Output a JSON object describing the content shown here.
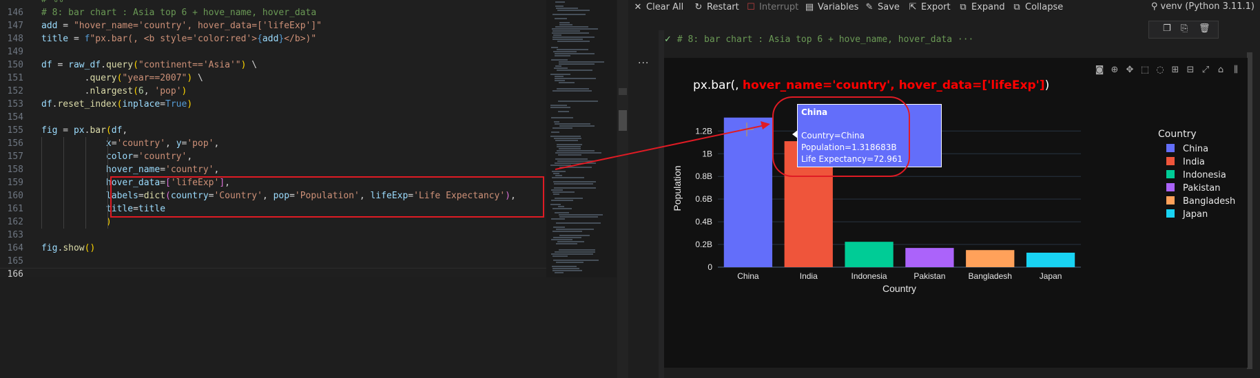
{
  "editor": {
    "lines": [
      {
        "no": "",
        "parts": [
          {
            "c": "t-c",
            "t": "# %%"
          }
        ]
      },
      {
        "no": "146",
        "parts": [
          {
            "c": "t-c",
            "t": "# 8: bar chart : Asia top 6 + hove_name, hover_data"
          }
        ]
      },
      {
        "no": "147",
        "parts": [
          {
            "c": "t-v",
            "t": "add"
          },
          {
            "c": "t-p",
            "t": " = "
          },
          {
            "c": "t-s",
            "t": "\"hover_name='country', hover_data=['lifeExp']\""
          }
        ]
      },
      {
        "no": "148",
        "parts": [
          {
            "c": "t-v",
            "t": "title"
          },
          {
            "c": "t-p",
            "t": " = "
          },
          {
            "c": "t-k",
            "t": "f"
          },
          {
            "c": "t-s",
            "t": "\"px.bar(, <b style='color:red'>"
          },
          {
            "c": "t-k",
            "t": "{"
          },
          {
            "c": "t-v",
            "t": "add"
          },
          {
            "c": "t-k",
            "t": "}"
          },
          {
            "c": "t-s",
            "t": "</b>)\""
          }
        ]
      },
      {
        "no": "149",
        "parts": []
      },
      {
        "no": "150",
        "parts": [
          {
            "c": "t-v",
            "t": "df"
          },
          {
            "c": "t-p",
            "t": " = "
          },
          {
            "c": "t-v",
            "t": "raw_df"
          },
          {
            "c": "t-p",
            "t": "."
          },
          {
            "c": "t-f",
            "t": "query"
          },
          {
            "c": "t-y",
            "t": "("
          },
          {
            "c": "t-s",
            "t": "\"continent=='Asia'\""
          },
          {
            "c": "t-y",
            "t": ")"
          },
          {
            "c": "t-p",
            "t": " \\"
          }
        ]
      },
      {
        "no": "151",
        "parts": [
          {
            "c": "t-p",
            "t": "        ."
          },
          {
            "c": "t-f",
            "t": "query"
          },
          {
            "c": "t-y",
            "t": "("
          },
          {
            "c": "t-s",
            "t": "\"year==2007\""
          },
          {
            "c": "t-y",
            "t": ")"
          },
          {
            "c": "t-p",
            "t": " \\"
          }
        ]
      },
      {
        "no": "152",
        "parts": [
          {
            "c": "t-p",
            "t": "        ."
          },
          {
            "c": "t-f",
            "t": "nlargest"
          },
          {
            "c": "t-y",
            "t": "("
          },
          {
            "c": "t-n",
            "t": "6"
          },
          {
            "c": "t-p",
            "t": ", "
          },
          {
            "c": "t-s",
            "t": "'pop'"
          },
          {
            "c": "t-y",
            "t": ")"
          }
        ]
      },
      {
        "no": "153",
        "parts": [
          {
            "c": "t-v",
            "t": "df"
          },
          {
            "c": "t-p",
            "t": "."
          },
          {
            "c": "t-f",
            "t": "reset_index"
          },
          {
            "c": "t-y",
            "t": "("
          },
          {
            "c": "t-v",
            "t": "inplace"
          },
          {
            "c": "t-p",
            "t": "="
          },
          {
            "c": "t-k",
            "t": "True"
          },
          {
            "c": "t-y",
            "t": ")"
          }
        ]
      },
      {
        "no": "154",
        "parts": []
      },
      {
        "no": "155",
        "parts": [
          {
            "c": "t-v",
            "t": "fig"
          },
          {
            "c": "t-p",
            "t": " = "
          },
          {
            "c": "t-v",
            "t": "px"
          },
          {
            "c": "t-p",
            "t": "."
          },
          {
            "c": "t-f",
            "t": "bar"
          },
          {
            "c": "t-y",
            "t": "("
          },
          {
            "c": "t-v",
            "t": "df"
          },
          {
            "c": "t-p",
            "t": ","
          }
        ]
      },
      {
        "no": "156",
        "parts": [
          {
            "c": "t-p",
            "t": "            "
          },
          {
            "c": "t-v",
            "t": "x"
          },
          {
            "c": "t-p",
            "t": "="
          },
          {
            "c": "t-s",
            "t": "'country'"
          },
          {
            "c": "t-p",
            "t": ", "
          },
          {
            "c": "t-v",
            "t": "y"
          },
          {
            "c": "t-p",
            "t": "="
          },
          {
            "c": "t-s",
            "t": "'pop'"
          },
          {
            "c": "t-p",
            "t": ","
          }
        ]
      },
      {
        "no": "157",
        "parts": [
          {
            "c": "t-p",
            "t": "            "
          },
          {
            "c": "t-v",
            "t": "color"
          },
          {
            "c": "t-p",
            "t": "="
          },
          {
            "c": "t-s",
            "t": "'country'"
          },
          {
            "c": "t-p",
            "t": ","
          }
        ]
      },
      {
        "no": "158",
        "parts": [
          {
            "c": "t-p",
            "t": "            "
          },
          {
            "c": "t-v",
            "t": "hover_name"
          },
          {
            "c": "t-p",
            "t": "="
          },
          {
            "c": "t-s",
            "t": "'country'"
          },
          {
            "c": "t-p",
            "t": ","
          }
        ]
      },
      {
        "no": "159",
        "parts": [
          {
            "c": "t-p",
            "t": "            "
          },
          {
            "c": "t-v",
            "t": "hover_data"
          },
          {
            "c": "t-p",
            "t": "="
          },
          {
            "c": "t-pk",
            "t": "["
          },
          {
            "c": "t-s",
            "t": "'lifeExp'"
          },
          {
            "c": "t-pk",
            "t": "]"
          },
          {
            "c": "t-p",
            "t": ","
          }
        ]
      },
      {
        "no": "160",
        "parts": [
          {
            "c": "t-p",
            "t": "            "
          },
          {
            "c": "t-v",
            "t": "labels"
          },
          {
            "c": "t-p",
            "t": "="
          },
          {
            "c": "t-f",
            "t": "dict"
          },
          {
            "c": "t-pk",
            "t": "("
          },
          {
            "c": "t-v",
            "t": "country"
          },
          {
            "c": "t-p",
            "t": "="
          },
          {
            "c": "t-s",
            "t": "'Country'"
          },
          {
            "c": "t-p",
            "t": ", "
          },
          {
            "c": "t-v",
            "t": "pop"
          },
          {
            "c": "t-p",
            "t": "="
          },
          {
            "c": "t-s",
            "t": "'Population'"
          },
          {
            "c": "t-p",
            "t": ", "
          },
          {
            "c": "t-v",
            "t": "lifeExp"
          },
          {
            "c": "t-p",
            "t": "="
          },
          {
            "c": "t-s",
            "t": "'Life Expectancy'"
          },
          {
            "c": "t-pk",
            "t": ")"
          },
          {
            "c": "t-p",
            "t": ","
          }
        ]
      },
      {
        "no": "161",
        "parts": [
          {
            "c": "t-p",
            "t": "            "
          },
          {
            "c": "t-v",
            "t": "title"
          },
          {
            "c": "t-p",
            "t": "="
          },
          {
            "c": "t-v",
            "t": "title"
          }
        ]
      },
      {
        "no": "162",
        "parts": [
          {
            "c": "t-p",
            "t": "            "
          },
          {
            "c": "t-y",
            "t": ")"
          }
        ]
      },
      {
        "no": "163",
        "parts": []
      },
      {
        "no": "164",
        "parts": [
          {
            "c": "t-v",
            "t": "fig"
          },
          {
            "c": "t-p",
            "t": "."
          },
          {
            "c": "t-f",
            "t": "show"
          },
          {
            "c": "t-y",
            "t": "()"
          }
        ]
      },
      {
        "no": "165",
        "parts": []
      },
      {
        "no": "166",
        "parts": [],
        "current": true
      }
    ]
  },
  "toolbar": {
    "clear_all": "Clear All",
    "restart": "Restart",
    "interrupt": "Interrupt",
    "variables": "Variables",
    "save": "Save",
    "export": "Export",
    "expand": "Expand",
    "collapse": "Collapse",
    "kernel": "venv (Python 3.11.1)"
  },
  "cell": {
    "header": "# 8: bar chart : Asia top 6 + hove_name, hover_data ···",
    "output_menu": "···"
  },
  "icons": {
    "clear_all": "close-icon",
    "restart": "restart-icon",
    "interrupt": "stop-icon",
    "variables": "variables-icon",
    "save": "save-icon",
    "export": "export-icon",
    "expand": "expand-icon",
    "collapse": "collapse-icon",
    "kernel": "kernel-icon",
    "cell_status": "check-icon"
  },
  "annotation_color": "#e01b24",
  "chart": {
    "title_plain": "px.bar(, ",
    "title_red": "hover_name='country', hover_data=['lifeExp']",
    "title_end": ")",
    "hover": {
      "title": "China",
      "line1": "Country=China",
      "line2": "Population=1.318683B",
      "line3": "Life Expectancy=72.961"
    }
  },
  "chart_data": {
    "type": "bar",
    "title": "px.bar(, hover_name='country', hover_data=['lifeExp'])",
    "xlabel": "Country",
    "ylabel": "Population",
    "categories": [
      "China",
      "India",
      "Indonesia",
      "Pakistan",
      "Bangladesh",
      "Japan"
    ],
    "values": [
      1318683096,
      1110396331,
      223547000,
      169270617,
      150448339,
      127467972
    ],
    "colors": [
      "#636efa",
      "#ef553b",
      "#00cc96",
      "#ab63fa",
      "#ffa15a",
      "#19d3f3"
    ],
    "ylim": [
      0,
      1390000000.0
    ],
    "yticks": [
      0,
      200000000,
      400000000,
      600000000,
      800000000,
      1000000000,
      1200000000
    ],
    "yticklabels": [
      "0",
      "0.2B",
      "0.4B",
      "0.6B",
      "0.8B",
      "1B",
      "1.2B"
    ],
    "legend_title": "Country",
    "legend_position": "right",
    "grid": true
  }
}
